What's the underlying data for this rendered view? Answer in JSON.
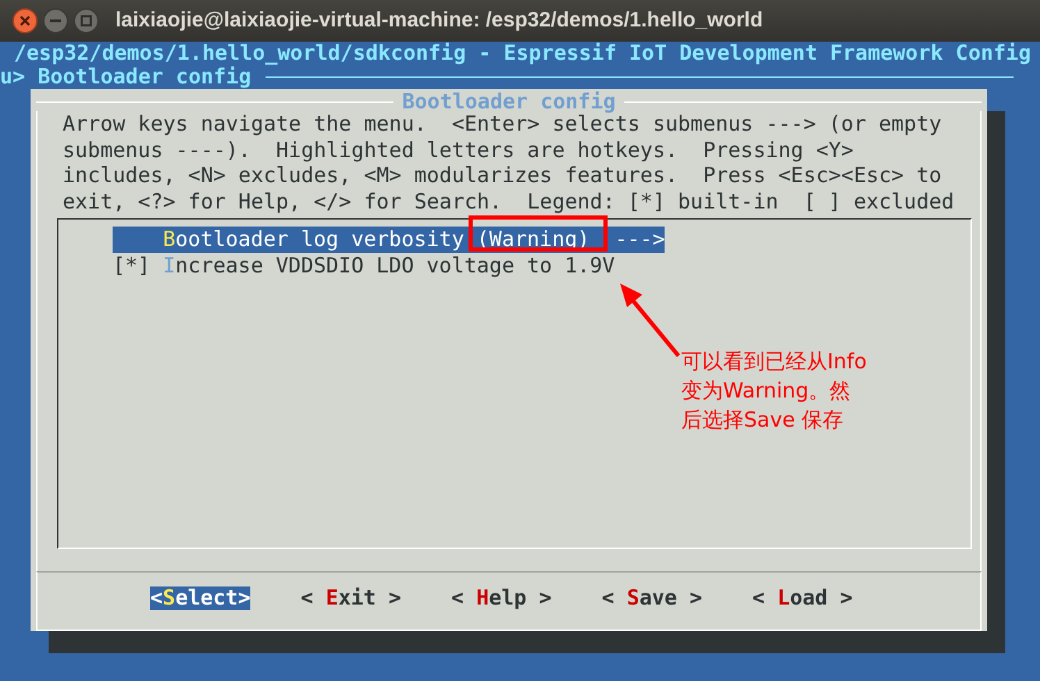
{
  "window": {
    "title": "laixiaojie@laixiaojie-virtual-machine: /esp32/demos/1.hello_world"
  },
  "terminal": {
    "header": "/esp32/demos/1.hello_world/sdkconfig - Espressif IoT Development Framework Config",
    "breadcrumb": "u> Bootloader config"
  },
  "dialog": {
    "title": "Bootloader config",
    "help_lines": [
      "Arrow keys navigate the menu.  <Enter> selects submenus ---> (or empty",
      "submenus ----).  Highlighted letters are hotkeys.  Pressing <Y>",
      "includes, <N> excludes, <M> modularizes features.  Press <Esc><Esc> to",
      "exit, <?> for Help, </> for Search.  Legend: [*] built-in  [ ] excluded"
    ],
    "items": [
      {
        "hotkey": "B",
        "rest": "ootloader log verbosity (Warning)",
        "arrow": "--->",
        "selected": true
      },
      {
        "prefix": "[*]",
        "hotkey": "I",
        "rest": "ncrease VDDSDIO LDO voltage to 1.9V",
        "selected": false
      }
    ],
    "buttons": [
      {
        "before": "<",
        "hotkey": "S",
        "after": "elect>",
        "selected": true
      },
      {
        "before": "< ",
        "hotkey": "E",
        "after": "xit >",
        "selected": false
      },
      {
        "before": "< ",
        "hotkey": "H",
        "after": "elp >",
        "selected": false
      },
      {
        "before": "< ",
        "hotkey": "S",
        "after": "ave >",
        "selected": false
      },
      {
        "before": "< ",
        "hotkey": "L",
        "after": "oad >",
        "selected": false
      }
    ]
  },
  "annotation": {
    "lines": [
      "可以看到已经从Info",
      "变为Warning。然",
      "后选择Save 保存"
    ]
  }
}
